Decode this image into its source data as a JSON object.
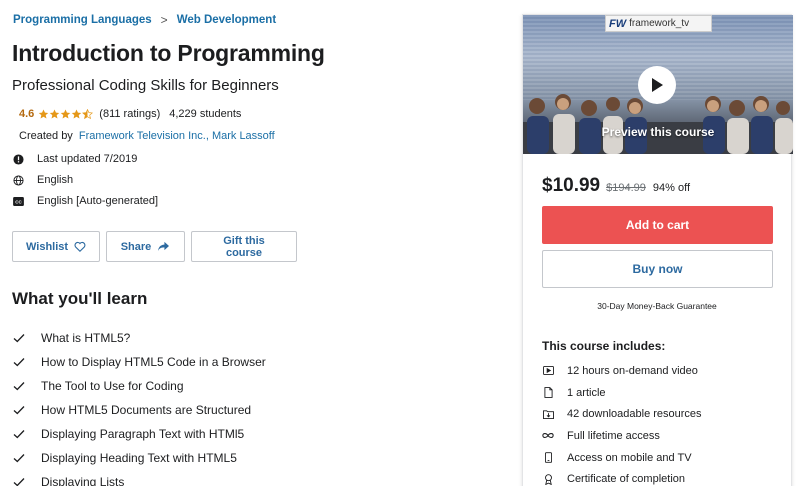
{
  "breadcrumb": {
    "items": [
      "Programming Languages",
      "Web Development"
    ],
    "separator": ">"
  },
  "course": {
    "title": "Introduction to Programming",
    "subtitle": "Professional Coding Skills for Beginners",
    "rating": "4.6",
    "stars": 4.5,
    "ratings_count": "(811 ratings)",
    "students": "4,229 students",
    "created_by_label": "Created by",
    "authors": "Framework Television Inc., Mark Lassoff",
    "last_updated": "Last updated 7/2019",
    "language": "English",
    "captions": "English [Auto-generated]"
  },
  "actions": {
    "wishlist": "Wishlist",
    "share": "Share",
    "gift": "Gift this course"
  },
  "learn": {
    "title": "What you'll learn",
    "items": [
      "What is HTML5?",
      "How to Display HTML5 Code in a Browser",
      "The Tool to Use for Coding",
      "How HTML5 Documents are Structured",
      "Displaying Paragraph Text with HTMl5",
      "Displaying Heading Text with HTML5",
      "Displaying Lists"
    ]
  },
  "sidebar": {
    "logo_mark": "FW",
    "logo_text": "framework_tv",
    "preview_label": "Preview this course",
    "price": "$10.99",
    "original_price": "$194.99",
    "discount": "94% off",
    "add_to_cart": "Add to cart",
    "buy_now": "Buy now",
    "guarantee": "30-Day Money-Back Guarantee",
    "includes_title": "This course includes:",
    "includes": [
      {
        "icon": "video-icon",
        "text": "12 hours on-demand video"
      },
      {
        "icon": "file-icon",
        "text": "1 article"
      },
      {
        "icon": "download-icon",
        "text": "42 downloadable resources"
      },
      {
        "icon": "infinity-icon",
        "text": "Full lifetime access"
      },
      {
        "icon": "mobile-icon",
        "text": "Access on mobile and TV"
      },
      {
        "icon": "certificate-icon",
        "text": "Certificate of completion"
      }
    ]
  },
  "colors": {
    "link": "#1b6fa6",
    "rating": "#b4690e",
    "cart": "#ec5252"
  }
}
